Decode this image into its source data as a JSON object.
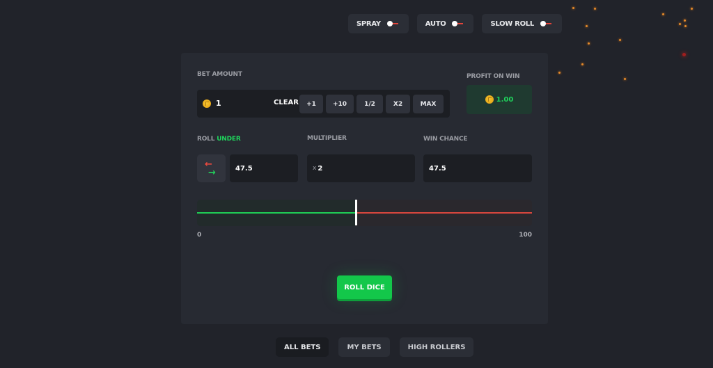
{
  "toggles": [
    {
      "label": "SPRAY",
      "on": false
    },
    {
      "label": "AUTO",
      "on": false
    },
    {
      "label": "SLOW ROLL",
      "on": false
    }
  ],
  "bet": {
    "label": "BET AMOUNT",
    "value": "1",
    "clear_label": "CLEAR",
    "quick_buttons": [
      "+1",
      "+10",
      "1/2",
      "X2",
      "MAX"
    ]
  },
  "profit": {
    "label": "PROFIT ON WIN",
    "value": "1.00"
  },
  "roll": {
    "label_prefix": "ROLL",
    "label_mode": "UNDER",
    "value": "47.5"
  },
  "multiplier": {
    "label": "MULTIPLIER",
    "prefix": "x",
    "value": "2"
  },
  "win_chance": {
    "label": "WIN CHANCE",
    "value": "47.5"
  },
  "slider": {
    "min_label": "0",
    "max_label": "100",
    "min": 0,
    "max": 100,
    "value": 47.5
  },
  "roll_button": "ROLL DICE",
  "tabs": [
    {
      "label": "ALL BETS",
      "active": true
    },
    {
      "label": "MY BETS",
      "active": false
    },
    {
      "label": "HIGH ROLLERS",
      "active": false
    }
  ],
  "colors": {
    "win": "#1fd45c",
    "lose": "#d9473d",
    "background": "#21232a",
    "panel": "#272a32"
  }
}
